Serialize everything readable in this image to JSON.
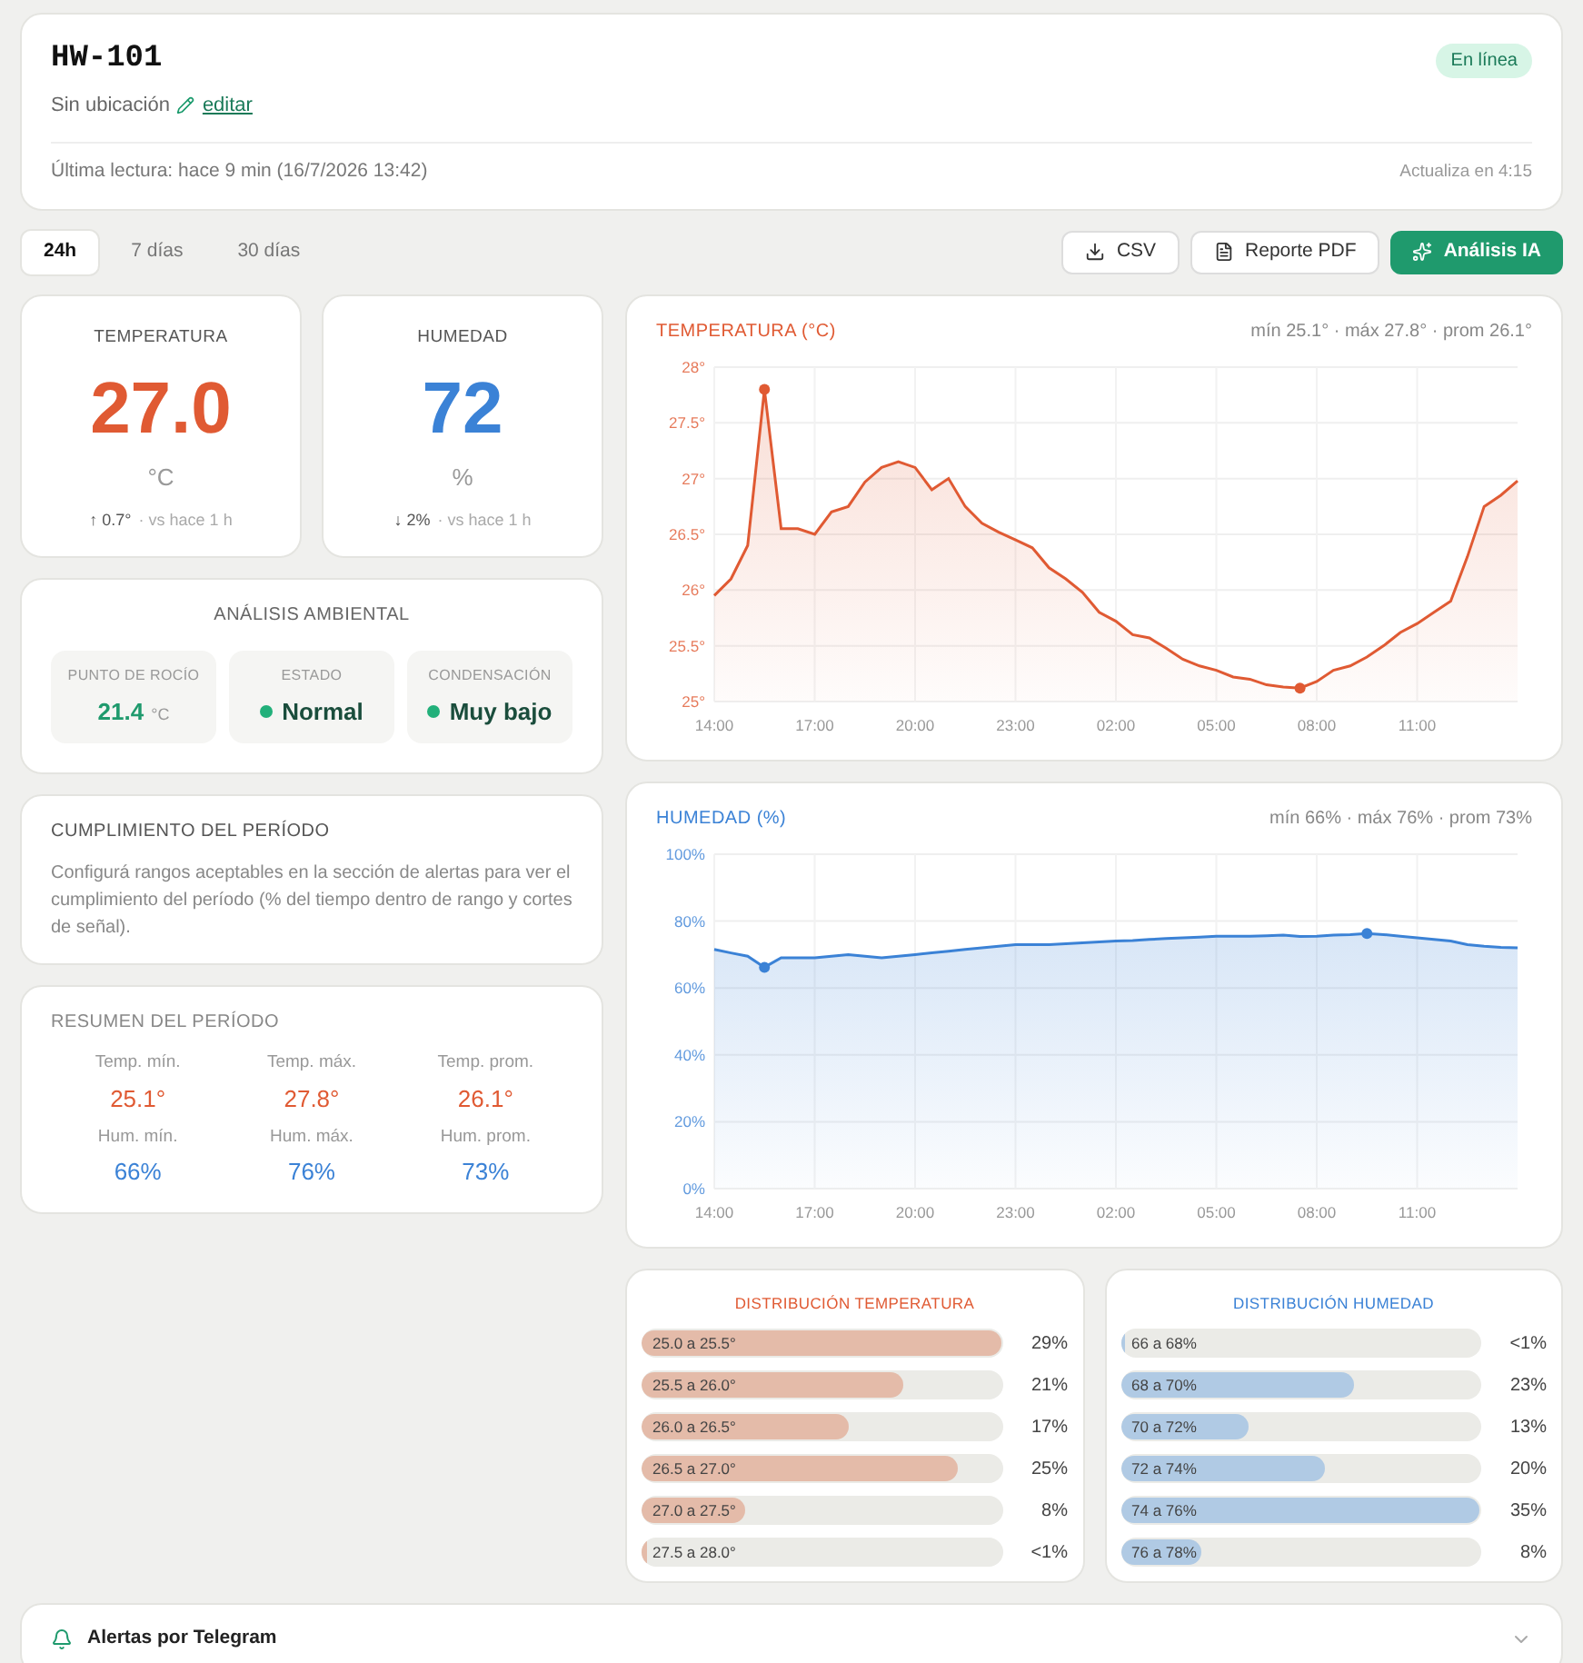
{
  "device": {
    "title": "HW-101",
    "location": "Sin ubicación",
    "edit_link": "editar",
    "status": "En línea",
    "last_reading": "Última lectura: hace 9 min (16/7/2026 13:42)",
    "refresh": "Actualiza en 4:15"
  },
  "tabs": [
    {
      "label": "24h",
      "selected": true
    },
    {
      "label": "7 días",
      "selected": false
    },
    {
      "label": "30 días",
      "selected": false
    }
  ],
  "actions": [
    {
      "label": "CSV",
      "kind": "outline"
    },
    {
      "label": "Reporte PDF",
      "kind": "outline"
    },
    {
      "label": "Análisis IA",
      "kind": "primary"
    }
  ],
  "readings": [
    {
      "kind": "temp",
      "label": "TEMPERATURA",
      "value": "27.0",
      "unit": "°C",
      "delta_arrow": "↑",
      "delta": "0.7°",
      "note": "· vs hace 1 h"
    },
    {
      "kind": "hum",
      "label": "HUMEDAD",
      "value": "72",
      "unit": "%",
      "delta_arrow": "↓",
      "delta": "2%",
      "note": "· vs hace 1 h"
    }
  ],
  "analysis": {
    "title": "ANÁLISIS AMBIENTAL",
    "items": [
      {
        "kind": "reading",
        "label": "PUNTO DE ROCÍO",
        "value": "21.4",
        "unit": "°C"
      },
      {
        "kind": "status",
        "label": "ESTADO",
        "value": "Normal"
      },
      {
        "kind": "status",
        "label": "CONDENSACIÓN",
        "value": "Muy bajo"
      }
    ]
  },
  "compliance": {
    "title": "CUMPLIMIENTO DEL PERÍODO",
    "text": "Configurá rangos aceptables en la sección de alertas para ver el cumplimiento del período (% del tiempo dentro de rango y cortes de señal)."
  },
  "summary": {
    "title": "RESUMEN DEL PERÍODO",
    "items": [
      {
        "kind": "temp",
        "label": "Temp. mín.",
        "value": "25.1°"
      },
      {
        "kind": "temp",
        "label": "Temp. máx.",
        "value": "27.8°"
      },
      {
        "kind": "temp",
        "label": "Temp. prom.",
        "value": "26.1°"
      },
      {
        "kind": "hum",
        "label": "Hum. mín.",
        "value": "66%"
      },
      {
        "kind": "hum",
        "label": "Hum. máx.",
        "value": "76%"
      },
      {
        "kind": "hum",
        "label": "Hum. prom.",
        "value": "73%"
      }
    ]
  },
  "charts": [
    {
      "kind": "temp",
      "title": "TEMPERATURA (°C)",
      "stats": "mín 25.1° · máx 27.8° · prom 26.1°",
      "chart_data": {
        "type": "area",
        "categories": [
          "14:00",
          null,
          null,
          null,
          null,
          null,
          "17:00",
          null,
          null,
          null,
          null,
          null,
          "20:00",
          null,
          null,
          null,
          null,
          null,
          "23:00",
          null,
          null,
          null,
          null,
          null,
          "02:00",
          null,
          null,
          null,
          null,
          null,
          "05:00",
          null,
          null,
          null,
          null,
          null,
          "08:00",
          null,
          null,
          null,
          null,
          null,
          "11:00",
          null,
          null,
          null,
          null,
          null,
          null
        ],
        "grid": true,
        "series": [
          {
            "color": "#e05a33",
            "values": [
              25.95,
              26.1,
              26.4,
              27.8,
              26.55,
              26.55,
              26.5,
              26.7,
              26.75,
              26.97,
              27.1,
              27.15,
              27.1,
              26.9,
              27.0,
              26.75,
              26.6,
              26.52,
              26.45,
              26.38,
              26.2,
              26.1,
              25.98,
              25.8,
              25.72,
              25.6,
              25.57,
              25.48,
              25.38,
              25.32,
              25.28,
              25.22,
              25.2,
              25.15,
              25.13,
              25.12,
              25.18,
              25.28,
              25.32,
              25.4,
              25.5,
              25.62,
              25.7,
              25.8,
              25.9,
              26.3,
              26.75,
              26.85,
              26.98
            ]
          }
        ],
        "ylim": [
          25,
          28
        ],
        "yticks": [
          {
            "value": 25,
            "label": "25°"
          },
          {
            "value": 25.5,
            "label": "25.5°"
          },
          {
            "value": 26,
            "label": "26°"
          },
          {
            "value": 26.5,
            "label": "26.5°"
          },
          {
            "value": 27,
            "label": "27°"
          },
          {
            "value": 27.5,
            "label": "27.5°"
          },
          {
            "value": 28,
            "label": "28°"
          }
        ]
      }
    },
    {
      "kind": "hum",
      "title": "HUMEDAD (%)",
      "stats": "mín 66% · máx 76% · prom 73%",
      "chart_data": {
        "type": "area",
        "categories": [
          "14:00",
          null,
          null,
          null,
          null,
          null,
          "17:00",
          null,
          null,
          null,
          null,
          null,
          "20:00",
          null,
          null,
          null,
          null,
          null,
          "23:00",
          null,
          null,
          null,
          null,
          null,
          "02:00",
          null,
          null,
          null,
          null,
          null,
          "05:00",
          null,
          null,
          null,
          null,
          null,
          "08:00",
          null,
          null,
          null,
          null,
          null,
          "11:00",
          null,
          null,
          null,
          null,
          null,
          null
        ],
        "grid": true,
        "series": [
          {
            "color": "#3b82d6",
            "values": [
              71.5,
              70.5,
              69.5,
              66.2,
              69,
              69,
              69,
              69.5,
              70,
              69.5,
              69,
              69.5,
              70,
              70.5,
              71,
              71.5,
              72,
              72.5,
              73,
              73,
              73,
              73.2,
              73.5,
              73.8,
              74,
              74.2,
              74.5,
              74.8,
              75,
              75.2,
              75.5,
              75.5,
              75.5,
              75.6,
              75.8,
              75.4,
              75.5,
              75.8,
              76,
              76.3,
              76,
              75.5,
              75,
              74.5,
              74,
              73,
              72.5,
              72.2,
              72
            ]
          }
        ],
        "ylim": [
          0,
          100
        ],
        "yticks": [
          {
            "value": 0,
            "label": "0%"
          },
          {
            "value": 20,
            "label": "20%"
          },
          {
            "value": 40,
            "label": "40%"
          },
          {
            "value": 60,
            "label": "60%"
          },
          {
            "value": 80,
            "label": "80%"
          },
          {
            "value": 100,
            "label": "100%"
          }
        ]
      }
    }
  ],
  "distributions": [
    {
      "kind": "temp",
      "title": "DISTRIBUCIÓN TEMPERATURA",
      "rows": [
        {
          "label": "25.0 a 25.5°",
          "level": 1.0,
          "reading": "29%"
        },
        {
          "label": "25.5 a 26.0°",
          "level": 0.73,
          "reading": "21%"
        },
        {
          "label": "26.0 a 26.5°",
          "level": 0.58,
          "reading": "17%"
        },
        {
          "label": "26.5 a 27.0°",
          "level": 0.88,
          "reading": "25%"
        },
        {
          "label": "27.0 a 27.5°",
          "level": 0.29,
          "reading": "8%"
        },
        {
          "label": "27.5 a 28.0°",
          "level": 0.02,
          "reading": "<1%"
        }
      ]
    },
    {
      "kind": "hum",
      "title": "DISTRIBUCIÓN HUMEDAD",
      "rows": [
        {
          "label": "66 a 68%",
          "level": 0.02,
          "reading": "<1%"
        },
        {
          "label": "68 a 70%",
          "level": 0.65,
          "reading": "23%"
        },
        {
          "label": "70 a 72%",
          "level": 0.36,
          "reading": "13%"
        },
        {
          "label": "72 a 74%",
          "level": 0.57,
          "reading": "20%"
        },
        {
          "label": "74 a 76%",
          "level": 1.0,
          "reading": "35%"
        },
        {
          "label": "76 a 78%",
          "level": 0.23,
          "reading": "8%"
        }
      ]
    }
  ],
  "alerts": {
    "title": "Alertas por Telegram",
    "expanded": false
  }
}
